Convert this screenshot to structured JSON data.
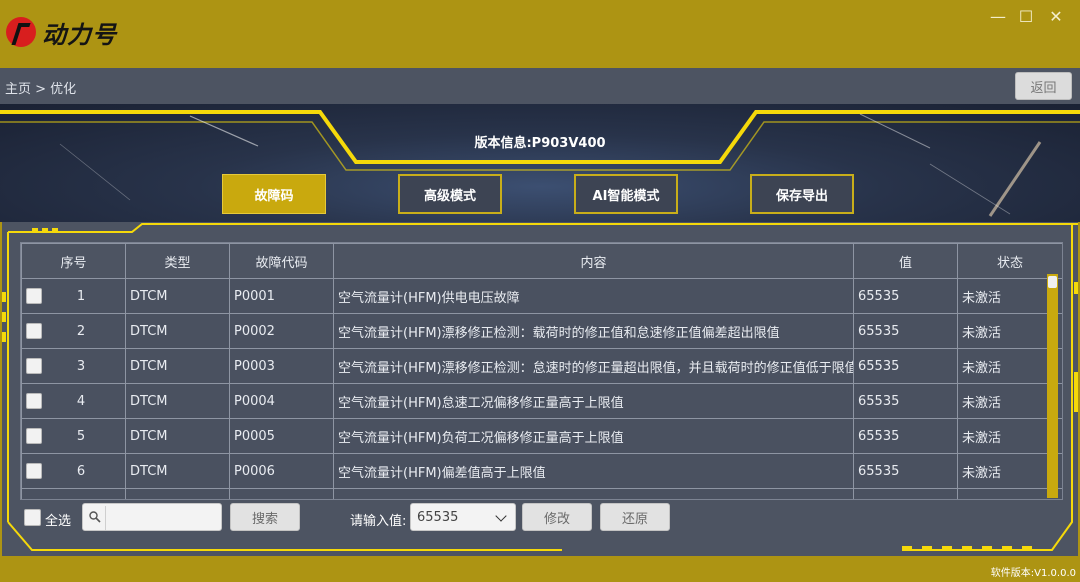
{
  "app": {
    "logo_text": "动力号",
    "logo_small": "1号"
  },
  "window": {
    "minimize": "—",
    "maximize": "☐",
    "close": "✕"
  },
  "nav": {
    "breadcrumb": "主页 > 优化",
    "back_label": "返回"
  },
  "banner": {
    "version": "版本信息:P903V400",
    "tabs": [
      {
        "label": "故障码",
        "active": true
      },
      {
        "label": "高级模式",
        "active": false
      },
      {
        "label": "AI智能模式",
        "active": false
      },
      {
        "label": "保存导出",
        "active": false
      }
    ]
  },
  "table": {
    "headers": [
      "序号",
      "类型",
      "故障代码",
      "内容",
      "值",
      "状态"
    ],
    "rows": [
      {
        "no": "1",
        "type": "DTCM",
        "code": "P0001",
        "content": "空气流量计(HFM)供电电压故障",
        "value": "65535",
        "status": "未激活"
      },
      {
        "no": "2",
        "type": "DTCM",
        "code": "P0002",
        "content": "空气流量计(HFM)漂移修正检测：载荷时的修正值和怠速修正值偏差超出限值",
        "value": "65535",
        "status": "未激活"
      },
      {
        "no": "3",
        "type": "DTCM",
        "code": "P0003",
        "content": "空气流量计(HFM)漂移修正检测：怠速时的修正量超出限值，并且载荷时的修正值低于限值",
        "value": "65535",
        "status": "未激活"
      },
      {
        "no": "4",
        "type": "DTCM",
        "code": "P0004",
        "content": "空气流量计(HFM)怠速工况偏移修正量高于上限值",
        "value": "65535",
        "status": "未激活"
      },
      {
        "no": "5",
        "type": "DTCM",
        "code": "P0005",
        "content": "空气流量计(HFM)负荷工况偏移修正量高于上限值",
        "value": "65535",
        "status": "未激活"
      },
      {
        "no": "6",
        "type": "DTCM",
        "code": "P0006",
        "content": "空气流量计(HFM)偏差值高于上限值",
        "value": "65535",
        "status": "未激活"
      }
    ]
  },
  "controls": {
    "select_all": "全选",
    "search_placeholder": "",
    "search_label": "搜索",
    "input_label": "请输入值:",
    "value_selected": "65535",
    "modify_label": "修改",
    "restore_label": "还原"
  },
  "footer": {
    "software_version": "软件版本:V1.0.0.0"
  },
  "colors": {
    "gold": "#ad9413",
    "panel": "#4d5462",
    "accent": "#f5d90a"
  }
}
